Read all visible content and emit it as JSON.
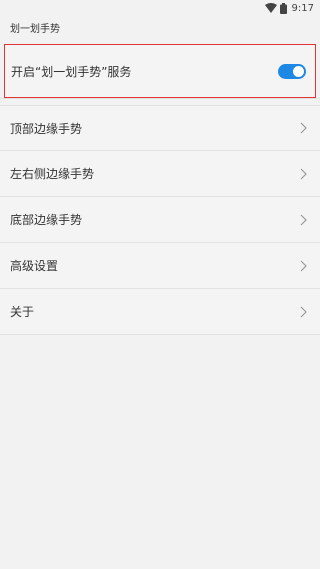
{
  "status_bar": {
    "time": "9:17"
  },
  "app_title": "划一划手势",
  "main_toggle": {
    "label": "开启“划一划手势”服务",
    "enabled": true,
    "accent_color": "#1e88e5"
  },
  "menu": [
    {
      "label": "顶部边缘手势"
    },
    {
      "label": "左右侧边缘手势"
    },
    {
      "label": "底部边缘手势"
    },
    {
      "label": "高级设置"
    },
    {
      "label": "关于"
    }
  ],
  "icons": {
    "chevron": "chevron-right-icon",
    "wifi": "wifi-icon",
    "battery": "battery-icon"
  }
}
